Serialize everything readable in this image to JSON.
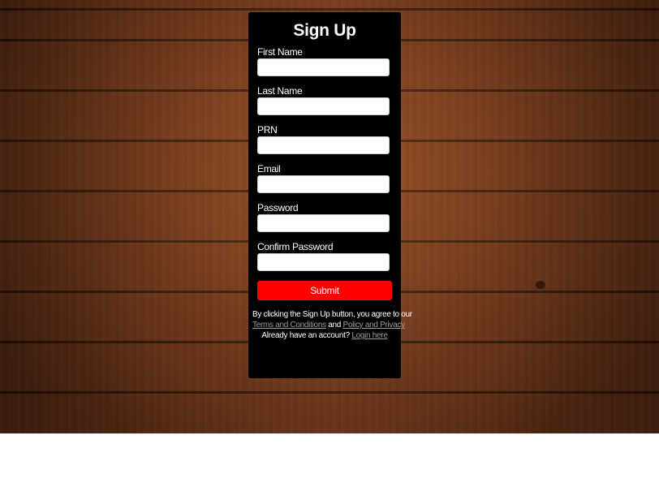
{
  "form": {
    "title": "Sign Up",
    "fields": [
      {
        "label": "First Name",
        "value": "",
        "type": "text"
      },
      {
        "label": "Last Name",
        "value": "",
        "type": "text"
      },
      {
        "label": "PRN",
        "value": "",
        "type": "text"
      },
      {
        "label": "Email",
        "value": "",
        "type": "email"
      },
      {
        "label": "Password",
        "value": "",
        "type": "password"
      },
      {
        "label": "Confirm Password",
        "value": "",
        "type": "password"
      }
    ],
    "submit_label": "Submit"
  },
  "footer": {
    "agree_text": "By clicking the Sign Up button, you agree to our",
    "terms_link": "Terms and Conditions",
    "and_text": "and",
    "privacy_link": "Policy and Privacy",
    "account_text": "Already have an account?",
    "login_link": "Login here"
  },
  "colors": {
    "card_bg": "#000000",
    "submit_bg": "#ff0000",
    "link_color": "#9a9a9a",
    "page_bg": "#ffffff"
  }
}
